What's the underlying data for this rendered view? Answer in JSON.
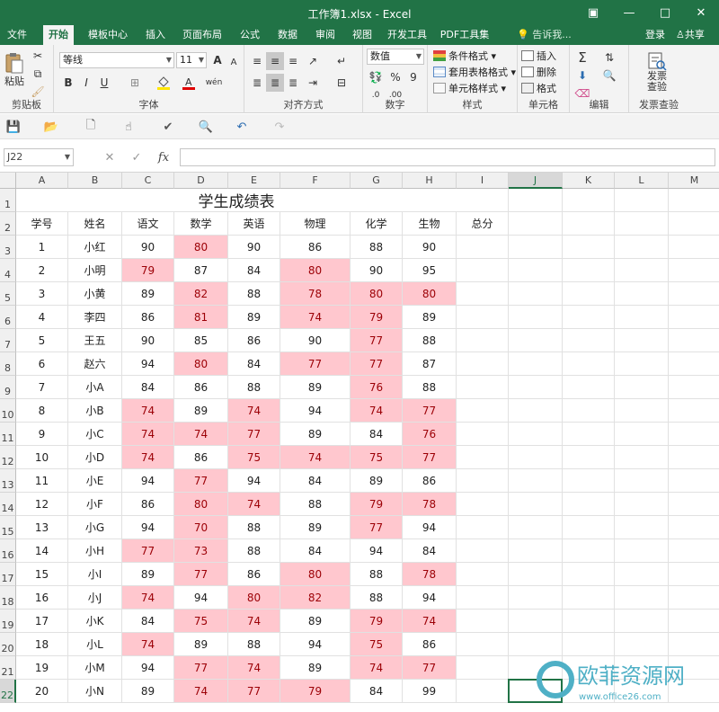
{
  "window": {
    "title": "工作簿1.xlsx - Excel",
    "minimize": "—",
    "restore": "□",
    "close": "✕",
    "ribbon_options": "▣"
  },
  "tabs": [
    "文件",
    "开始",
    "模板中心",
    "插入",
    "页面布局",
    "公式",
    "数据",
    "审阅",
    "视图",
    "开发工具",
    "PDF工具集"
  ],
  "active_tab": "开始",
  "tell_me": "告诉我...",
  "login": "登录",
  "share": "共享",
  "ribbon": {
    "clipboard": {
      "label": "剪贴板",
      "paste": "粘贴"
    },
    "font": {
      "label": "字体",
      "name": "等线",
      "size": "11",
      "bold": "B",
      "italic": "I",
      "underline": "U",
      "grow": "A",
      "shrink": "A",
      "wen": "wén"
    },
    "align": {
      "label": "对齐方式"
    },
    "number": {
      "label": "数字",
      "format": "数值",
      "percent": "%",
      "comma": "9"
    },
    "styles": {
      "label": "样式",
      "conditional": "条件格式",
      "table": "套用表格格式",
      "cell": "单元格样式"
    },
    "cells": {
      "label": "单元格",
      "insert": "插入",
      "delete": "删除",
      "format": "格式"
    },
    "edit": {
      "label": "编辑"
    },
    "check": {
      "label": "发票查验",
      "button_line1": "发票",
      "button_line2": "查验"
    }
  },
  "name_box": "J22",
  "formula_bar": {
    "cancel": "✕",
    "enter": "✓",
    "fx": "fx",
    "value": ""
  },
  "columns": [
    "A",
    "B",
    "C",
    "D",
    "E",
    "F",
    "G",
    "H",
    "I",
    "J",
    "K",
    "L",
    "M"
  ],
  "rows": [
    "1",
    "2",
    "3",
    "4",
    "5",
    "6",
    "7",
    "8",
    "9",
    "10",
    "11",
    "12",
    "13",
    "14",
    "15",
    "16",
    "17",
    "18",
    "19",
    "20",
    "21",
    "22"
  ],
  "selected_column": "J",
  "selected_row": "22",
  "sheet": {
    "title": "学生成绩表",
    "headers": [
      "学号",
      "姓名",
      "语文",
      "数学",
      "英语",
      "物理",
      "化学",
      "生物",
      "总分"
    ],
    "students": [
      {
        "id": "1",
        "name": "小红",
        "scores": [
          "90",
          "80",
          "90",
          "86",
          "88",
          "90"
        ],
        "pink": [
          false,
          true,
          false,
          false,
          false,
          false
        ]
      },
      {
        "id": "2",
        "name": "小明",
        "scores": [
          "79",
          "87",
          "84",
          "80",
          "90",
          "95"
        ],
        "pink": [
          true,
          false,
          false,
          true,
          false,
          false
        ]
      },
      {
        "id": "3",
        "name": "小黄",
        "scores": [
          "89",
          "82",
          "88",
          "78",
          "80",
          "80"
        ],
        "pink": [
          false,
          true,
          false,
          true,
          true,
          true
        ]
      },
      {
        "id": "4",
        "name": "李四",
        "scores": [
          "86",
          "81",
          "89",
          "74",
          "79",
          "89"
        ],
        "pink": [
          false,
          true,
          false,
          true,
          true,
          false
        ]
      },
      {
        "id": "5",
        "name": "王五",
        "scores": [
          "90",
          "85",
          "86",
          "90",
          "77",
          "88"
        ],
        "pink": [
          false,
          false,
          false,
          false,
          true,
          false
        ]
      },
      {
        "id": "6",
        "name": "赵六",
        "scores": [
          "94",
          "80",
          "84",
          "77",
          "77",
          "87"
        ],
        "pink": [
          false,
          true,
          false,
          true,
          true,
          false
        ]
      },
      {
        "id": "7",
        "name": "小A",
        "scores": [
          "84",
          "86",
          "88",
          "89",
          "76",
          "88"
        ],
        "pink": [
          false,
          false,
          false,
          false,
          true,
          false
        ]
      },
      {
        "id": "8",
        "name": "小B",
        "scores": [
          "74",
          "89",
          "74",
          "94",
          "74",
          "77"
        ],
        "pink": [
          true,
          false,
          true,
          false,
          true,
          true
        ]
      },
      {
        "id": "9",
        "name": "小C",
        "scores": [
          "74",
          "74",
          "77",
          "89",
          "84",
          "76"
        ],
        "pink": [
          true,
          true,
          true,
          false,
          false,
          true
        ]
      },
      {
        "id": "10",
        "name": "小D",
        "scores": [
          "74",
          "86",
          "75",
          "74",
          "75",
          "77"
        ],
        "pink": [
          true,
          false,
          true,
          true,
          true,
          true
        ]
      },
      {
        "id": "11",
        "name": "小E",
        "scores": [
          "94",
          "77",
          "94",
          "84",
          "89",
          "86"
        ],
        "pink": [
          false,
          true,
          false,
          false,
          false,
          false
        ]
      },
      {
        "id": "12",
        "name": "小F",
        "scores": [
          "86",
          "80",
          "74",
          "88",
          "79",
          "78"
        ],
        "pink": [
          false,
          true,
          true,
          false,
          true,
          true
        ]
      },
      {
        "id": "13",
        "name": "小G",
        "scores": [
          "94",
          "70",
          "88",
          "89",
          "77",
          "94"
        ],
        "pink": [
          false,
          true,
          false,
          false,
          true,
          false
        ]
      },
      {
        "id": "14",
        "name": "小H",
        "scores": [
          "77",
          "73",
          "88",
          "84",
          "94",
          "84"
        ],
        "pink": [
          true,
          true,
          false,
          false,
          false,
          false
        ]
      },
      {
        "id": "15",
        "name": "小I",
        "scores": [
          "89",
          "77",
          "86",
          "80",
          "88",
          "78"
        ],
        "pink": [
          false,
          true,
          false,
          true,
          false,
          true
        ]
      },
      {
        "id": "16",
        "name": "小J",
        "scores": [
          "74",
          "94",
          "80",
          "82",
          "88",
          "94"
        ],
        "pink": [
          true,
          false,
          true,
          true,
          false,
          false
        ]
      },
      {
        "id": "17",
        "name": "小K",
        "scores": [
          "84",
          "75",
          "74",
          "89",
          "79",
          "74"
        ],
        "pink": [
          false,
          true,
          true,
          false,
          true,
          true
        ]
      },
      {
        "id": "18",
        "name": "小L",
        "scores": [
          "74",
          "89",
          "88",
          "94",
          "75",
          "86"
        ],
        "pink": [
          true,
          false,
          false,
          false,
          true,
          false
        ]
      },
      {
        "id": "19",
        "name": "小M",
        "scores": [
          "94",
          "77",
          "74",
          "89",
          "74",
          "77"
        ],
        "pink": [
          false,
          true,
          true,
          false,
          true,
          true
        ]
      },
      {
        "id": "20",
        "name": "小N",
        "scores": [
          "89",
          "74",
          "77",
          "79",
          "84",
          "99"
        ],
        "pink": [
          false,
          true,
          true,
          true,
          false,
          false
        ]
      }
    ]
  },
  "watermark": {
    "name": "欧菲资源网",
    "url": "www.office26.com",
    "color": "#4fb0c6"
  },
  "colors": {
    "accent": "#217346",
    "pink_fill": "#ffc7ce",
    "pink_text": "#9c0006"
  }
}
